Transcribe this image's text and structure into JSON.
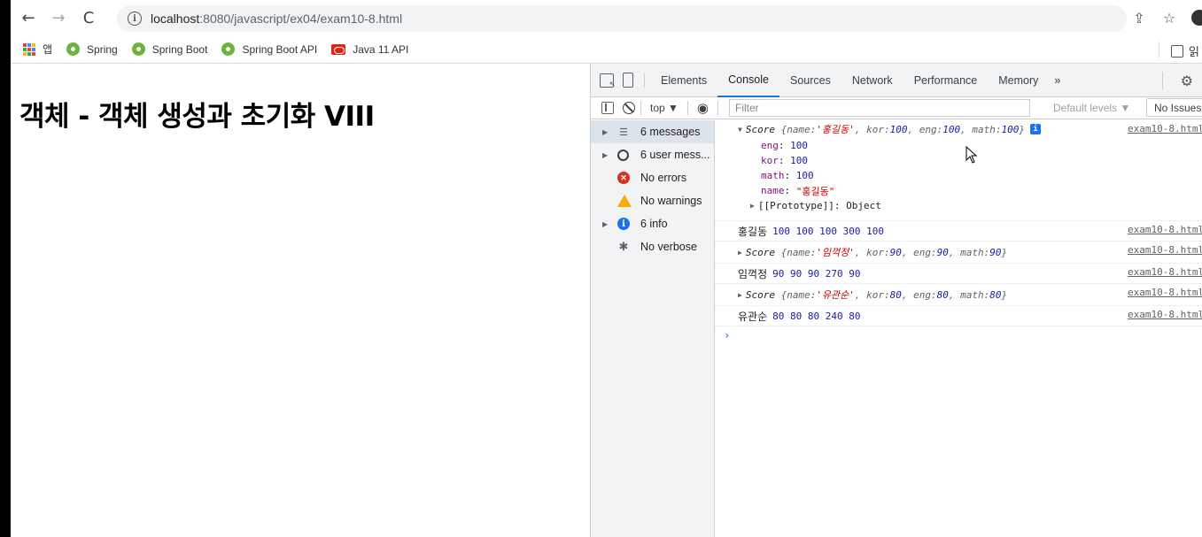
{
  "browser": {
    "url_host": "localhost",
    "url_path": ":8080/javascript/ex04/exam10-8.html",
    "bookmarks": [
      {
        "label": "앱",
        "icon": "apps-grid-icon"
      },
      {
        "label": "Spring",
        "icon": "spring-leaf-icon"
      },
      {
        "label": "Spring Boot",
        "icon": "spring-leaf-icon"
      },
      {
        "label": "Spring Boot API",
        "icon": "spring-leaf-icon"
      },
      {
        "label": "Java 11 API",
        "icon": "oracle-icon"
      }
    ],
    "right_bookmark_partial": "읽"
  },
  "page": {
    "heading": "객체 - 객체 생성과 초기화 VIII"
  },
  "devtools": {
    "tabs": [
      "Elements",
      "Console",
      "Sources",
      "Network",
      "Performance",
      "Memory"
    ],
    "active_tab": "Console",
    "more_tabs": "»",
    "context": "top ▼",
    "filter_placeholder": "Filter",
    "levels": "Default levels ▼",
    "issues": "No Issues",
    "sidebar": [
      {
        "label": "6 messages",
        "icon": "list-icon",
        "expandable": true,
        "selected": true
      },
      {
        "label": "6 user mess...",
        "icon": "user-icon",
        "expandable": true
      },
      {
        "label": "No errors",
        "icon": "error-icon",
        "expandable": false
      },
      {
        "label": "No warnings",
        "icon": "warning-icon",
        "expandable": false
      },
      {
        "label": "6 info",
        "icon": "info-icon",
        "expandable": true
      },
      {
        "label": "No verbose",
        "icon": "bug-icon",
        "expandable": false
      }
    ],
    "console": {
      "source": "exam10-8.html",
      "obj1": {
        "cls": "Score",
        "name": "'홍길동'",
        "kor": "100",
        "eng": "100",
        "math": "100",
        "props": [
          {
            "key": "eng",
            "value": "100"
          },
          {
            "key": "kor",
            "value": "100"
          },
          {
            "key": "math",
            "value": "100"
          },
          {
            "key": "name",
            "value": "\"홍길동\""
          }
        ],
        "proto": "[[Prototype]]: Object"
      },
      "line1": {
        "name": "홍길동",
        "nums": "100 100 100 300 100"
      },
      "obj2": {
        "cls": "Score",
        "name": "'임꺽정'",
        "kor": "90",
        "eng": "90",
        "math": "90"
      },
      "line2": {
        "name": "임꺽정",
        "nums": "90 90 90 270 90"
      },
      "obj3": {
        "cls": "Score",
        "name": "'유관순'",
        "kor": "80",
        "eng": "80",
        "math": "80"
      },
      "line3": {
        "name": "유관순",
        "nums": "80 80 80 240 80"
      },
      "prompt": "›"
    }
  }
}
